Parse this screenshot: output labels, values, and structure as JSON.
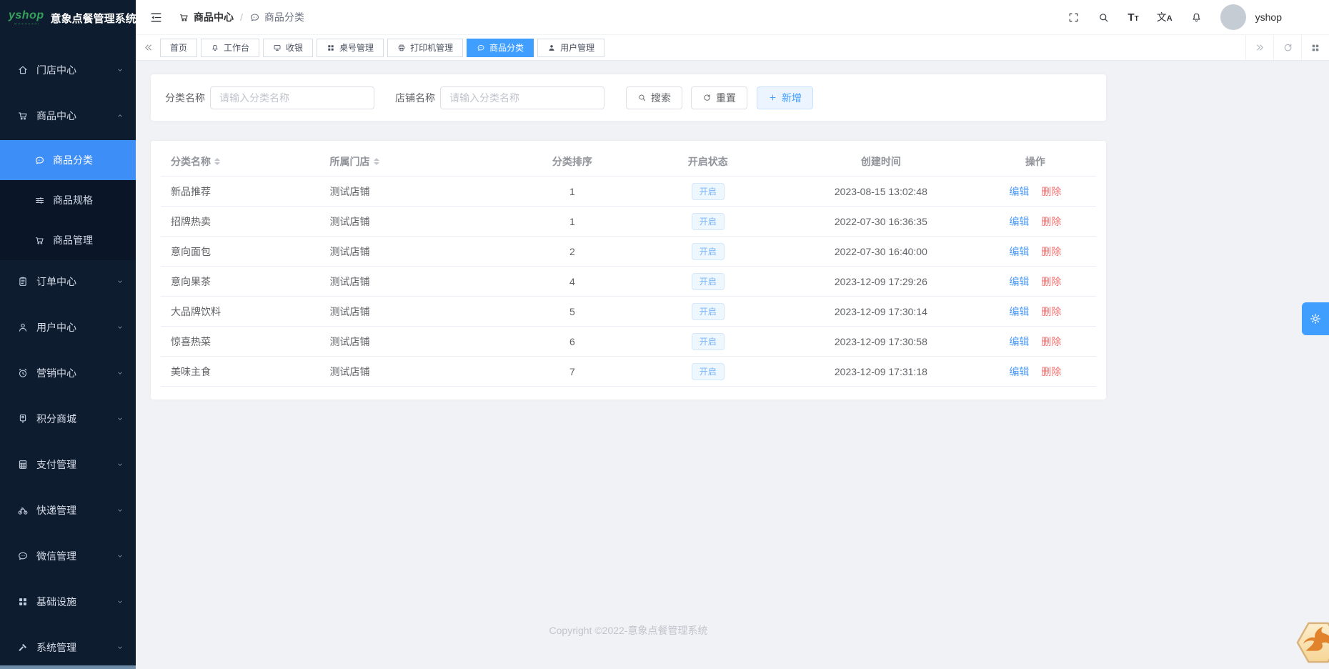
{
  "colors": {
    "accent": "#409eff",
    "sidebar_bg": "#0e1c30",
    "sidebar_submenu_bg": "#0a1527",
    "active_item_blue": "#3e8ef7",
    "danger_red": "#f56c6c",
    "status_tag_bg": "#eef6fe",
    "status_tag_text": "#7ab5f7",
    "main_bg": "#f0f2f5",
    "logo_green": "#35a25c"
  },
  "brand": {
    "logo_text": "yshop",
    "app_title": "意象点餐管理系统"
  },
  "breadcrumb": {
    "separator": "/",
    "items": [
      {
        "icon": "cart",
        "label": "商品中心"
      },
      {
        "icon": "chat",
        "label": "商品分类"
      }
    ]
  },
  "topbar": {
    "username": "yshop",
    "font_icon_large": "T",
    "font_icon_small": "T",
    "translate_zh": "文",
    "translate_en": "A"
  },
  "sidebar": {
    "items": [
      {
        "key": "store-center",
        "icon": "home",
        "label": "门店中心",
        "expanded": false
      },
      {
        "key": "product-center",
        "icon": "cart",
        "label": "商品中心",
        "expanded": true,
        "children": [
          {
            "key": "product-category",
            "icon": "chat",
            "label": "商品分类",
            "active": true
          },
          {
            "key": "product-spec",
            "icon": "sliders",
            "label": "商品规格",
            "active": false
          },
          {
            "key": "product-management",
            "icon": "cart",
            "label": "商品管理",
            "active": false
          }
        ]
      },
      {
        "key": "order-center",
        "icon": "clipboard",
        "label": "订单中心",
        "expanded": false
      },
      {
        "key": "user-center",
        "icon": "user",
        "label": "用户中心",
        "expanded": false
      },
      {
        "key": "marketing-center",
        "icon": "alarm",
        "label": "营销中心",
        "expanded": false
      },
      {
        "key": "points-mall",
        "icon": "medal",
        "label": "积分商城",
        "expanded": false
      },
      {
        "key": "payment-management",
        "icon": "calculator",
        "label": "支付管理",
        "expanded": false
      },
      {
        "key": "express-management",
        "icon": "bicycle",
        "label": "快递管理",
        "expanded": false
      },
      {
        "key": "wechat-management",
        "icon": "chat",
        "label": "微信管理",
        "expanded": false
      },
      {
        "key": "infrastructure",
        "icon": "grid4",
        "label": "基础设施",
        "expanded": false
      },
      {
        "key": "system-management",
        "icon": "hammer",
        "label": "系统管理",
        "expanded": false
      }
    ]
  },
  "tabs": {
    "items": [
      {
        "key": "home",
        "icon": null,
        "label": "首页",
        "active": false
      },
      {
        "key": "workbench",
        "icon": "bell",
        "label": "工作台",
        "active": false
      },
      {
        "key": "cashier",
        "icon": "monitor",
        "label": "收银",
        "active": false
      },
      {
        "key": "table-management",
        "icon": "grid4",
        "label": "桌号管理",
        "active": false
      },
      {
        "key": "printer-management",
        "icon": "printer",
        "label": "打印机管理",
        "active": false
      },
      {
        "key": "product-category",
        "icon": "chat",
        "label": "商品分类",
        "active": true
      },
      {
        "key": "user-management",
        "icon": "userFilled",
        "label": "用户管理",
        "active": false
      }
    ]
  },
  "filters": {
    "category_label": "分类名称",
    "category_placeholder": "请输入分类名称",
    "store_label": "店铺名称",
    "store_placeholder": "请输入分类名称",
    "search_label": "搜索",
    "reset_label": "重置",
    "add_label": "新增"
  },
  "table": {
    "columns": [
      {
        "key": "category-name",
        "label": "分类名称",
        "sortable": true,
        "align": "left",
        "width": "17%"
      },
      {
        "key": "store",
        "label": "所属门店",
        "sortable": true,
        "align": "left",
        "width": "21%"
      },
      {
        "key": "sort-order",
        "label": "分类排序",
        "sortable": false,
        "align": "center",
        "width": "12%"
      },
      {
        "key": "status",
        "label": "开启状态",
        "sortable": false,
        "align": "center",
        "width": "17%"
      },
      {
        "key": "created-time",
        "label": "创建时间",
        "sortable": false,
        "align": "center",
        "width": "20%"
      },
      {
        "key": "actions",
        "label": "操作",
        "sortable": false,
        "align": "center",
        "width": "13%"
      }
    ],
    "rows": [
      {
        "name": "新品推荐",
        "store": "测试店铺",
        "sort": "1",
        "status": "开启",
        "created": "2023-08-15 13:02:48"
      },
      {
        "name": "招牌热卖",
        "store": "测试店铺",
        "sort": "1",
        "status": "开启",
        "created": "2022-07-30 16:36:35"
      },
      {
        "name": "意向面包",
        "store": "测试店铺",
        "sort": "2",
        "status": "开启",
        "created": "2022-07-30 16:40:00"
      },
      {
        "name": "意向果茶",
        "store": "测试店铺",
        "sort": "4",
        "status": "开启",
        "created": "2023-12-09 17:29:26"
      },
      {
        "name": "大品牌饮料",
        "store": "测试店铺",
        "sort": "5",
        "status": "开启",
        "created": "2023-12-09 17:30:14"
      },
      {
        "name": "惊喜热菜",
        "store": "测试店铺",
        "sort": "6",
        "status": "开启",
        "created": "2023-12-09 17:30:58"
      },
      {
        "name": "美味主食",
        "store": "测试店铺",
        "sort": "7",
        "status": "开启",
        "created": "2023-12-09 17:31:18"
      }
    ],
    "actions": {
      "edit": "编辑",
      "delete": "删除"
    }
  },
  "footer": {
    "copyright": "Copyright ©2022-意象点餐管理系统"
  }
}
